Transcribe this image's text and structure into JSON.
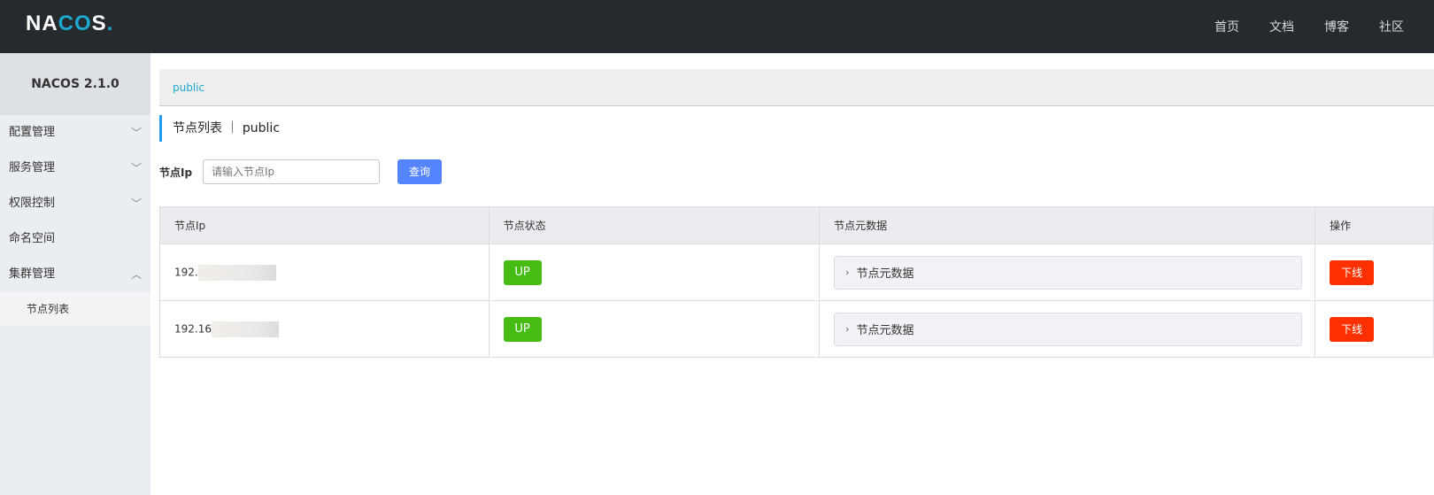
{
  "header": {
    "logo": {
      "left": "NA",
      "accent": "CO",
      "right": "S",
      "dot": "."
    },
    "nav": [
      "首页",
      "文档",
      "博客",
      "社区"
    ]
  },
  "sidebar": {
    "version": "NACOS 2.1.0",
    "menu": [
      {
        "label": "配置管理",
        "chevron": "﹀"
      },
      {
        "label": "服务管理",
        "chevron": "﹀"
      },
      {
        "label": "权限控制",
        "chevron": "﹀"
      },
      {
        "label": "命名空间",
        "chevron": ""
      },
      {
        "label": "集群管理",
        "chevron": "︿"
      }
    ],
    "submenu": [
      "节点列表"
    ]
  },
  "breadcrumb": "public",
  "page_heading": "节点列表 ｜ public",
  "filter": {
    "label": "节点Ip",
    "placeholder": "请输入节点Ip",
    "search_button": "查询"
  },
  "table": {
    "columns": [
      "节点Ip",
      "节点状态",
      "节点元数据",
      "操作"
    ],
    "rows": [
      {
        "ip": "192.",
        "status": "UP",
        "metadata": "节点元数据",
        "action": "下线"
      },
      {
        "ip": "192.16",
        "status": "UP",
        "metadata": "节点元数据",
        "action": "下线"
      }
    ]
  },
  "colors": {
    "topbar": "#252a2f",
    "accent": "#1ea8cf",
    "primary_button": "#5584ff",
    "status_up": "#46bc15",
    "danger": "#ff3000"
  }
}
